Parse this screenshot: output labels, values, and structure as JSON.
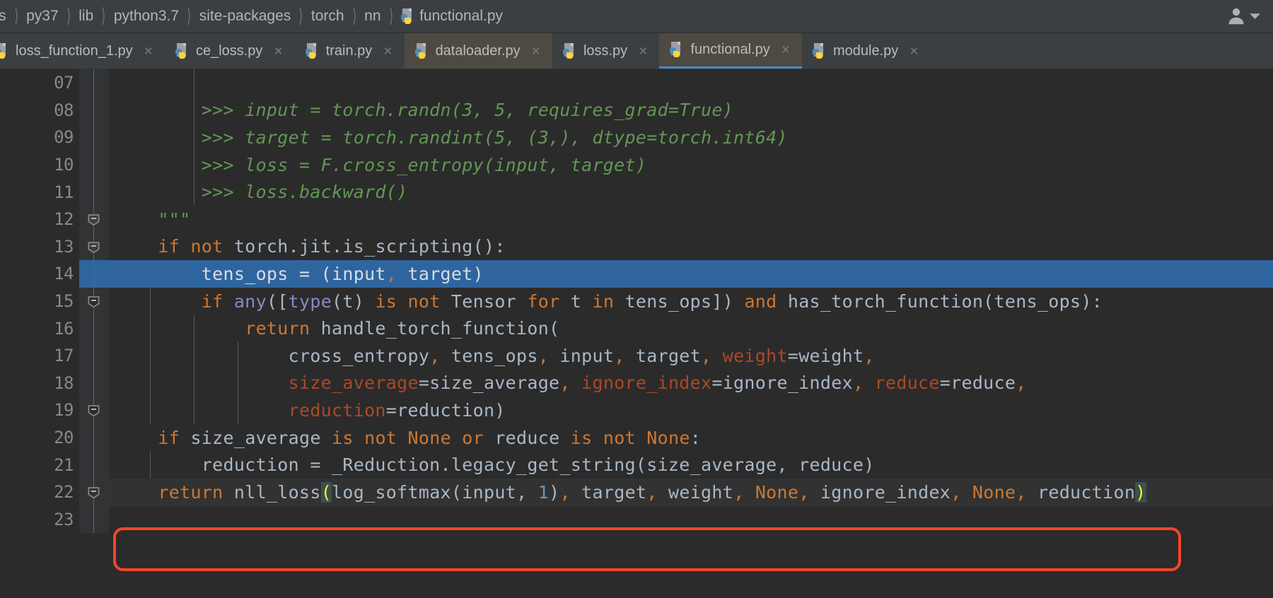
{
  "window": {
    "theme_bg": "#2b2b2b",
    "chrome_bg": "#3c3f41",
    "accent": "#4a88c7",
    "selection": "#2f659e",
    "annotation_color": "#f4452a"
  },
  "breadcrumb": {
    "items": [
      {
        "label": "s",
        "icon": null
      },
      {
        "label": "py37",
        "icon": null
      },
      {
        "label": "lib",
        "icon": null
      },
      {
        "label": "python3.7",
        "icon": null
      },
      {
        "label": "site-packages",
        "icon": null
      },
      {
        "label": "torch",
        "icon": null
      },
      {
        "label": "nn",
        "icon": null
      },
      {
        "label": "functional.py",
        "icon": "python-file-icon"
      }
    ],
    "separator": "〉",
    "account_icon": "user-avatar-icon",
    "account_chevron": "chevron-down-icon"
  },
  "tabs": [
    {
      "label": "loss_function_1.py",
      "icon": "python-file-icon",
      "close": "×",
      "active": false
    },
    {
      "label": "ce_loss.py",
      "icon": "python-file-icon",
      "close": "×",
      "active": false
    },
    {
      "label": "train.py",
      "icon": "python-file-icon",
      "close": "×",
      "active": false
    },
    {
      "label": "dataloader.py",
      "icon": "python-file-icon",
      "close": "×",
      "active": false
    },
    {
      "label": "loss.py",
      "icon": "python-file-icon",
      "close": "×",
      "active": false
    },
    {
      "label": "functional.py",
      "icon": "python-file-icon",
      "close": "×",
      "active": true
    },
    {
      "label": "module.py",
      "icon": "python-file-icon",
      "close": "×",
      "active": false
    }
  ],
  "editor": {
    "filename": "functional.py",
    "line_numbers": [
      "07",
      "08",
      "09",
      "10",
      "11",
      "12",
      "13",
      "14",
      "15",
      "16",
      "17",
      "18",
      "19",
      "20",
      "21",
      "22",
      "23"
    ],
    "selected_line": "14",
    "caret_line": "22",
    "lines": [
      {
        "n": "07",
        "text": ""
      },
      {
        "n": "08",
        "text": "        >>> input = torch.randn(3, 5, requires_grad=True)"
      },
      {
        "n": "09",
        "text": "        >>> target = torch.randint(5, (3,), dtype=torch.int64)"
      },
      {
        "n": "10",
        "text": "        >>> loss = F.cross_entropy(input, target)"
      },
      {
        "n": "11",
        "text": "        >>> loss.backward()"
      },
      {
        "n": "12",
        "text": "    \"\"\""
      },
      {
        "n": "13",
        "text": "    if not torch.jit.is_scripting():"
      },
      {
        "n": "14",
        "text": "        tens_ops = (input, target)"
      },
      {
        "n": "15",
        "text": "        if any([type(t) is not Tensor for t in tens_ops]) and has_torch_function(tens_ops):"
      },
      {
        "n": "16",
        "text": "            return handle_torch_function("
      },
      {
        "n": "17",
        "text": "                cross_entropy, tens_ops, input, target, weight=weight,"
      },
      {
        "n": "18",
        "text": "                size_average=size_average, ignore_index=ignore_index, reduce=reduce,"
      },
      {
        "n": "19",
        "text": "                reduction=reduction)"
      },
      {
        "n": "20",
        "text": "    if size_average is not None or reduce is not None:"
      },
      {
        "n": "21",
        "text": "        reduction = _Reduction.legacy_get_string(size_average, reduce)"
      },
      {
        "n": "22",
        "text": "    return nll_loss(log_softmax(input, 1), target, weight, None, ignore_index, None, reduction)"
      },
      {
        "n": "23",
        "text": ""
      }
    ],
    "fold_markers": [
      "12",
      "13",
      "15",
      "19",
      "22"
    ],
    "annotation": {
      "type": "red-rounded-rectangle",
      "target_line": "22",
      "color": "#f4452a"
    },
    "bracket_match": {
      "open": "(",
      "close": ")",
      "highlight_bg": "#3b514d",
      "highlight_fg": "#ffef28"
    }
  },
  "syntax_colors": {
    "keyword": "#cc7832",
    "builtin": "#8888c6",
    "docstring": "#629755",
    "number": "#6897bb",
    "kwarg": "#aa4926",
    "identifier": "#a9b7c6"
  }
}
